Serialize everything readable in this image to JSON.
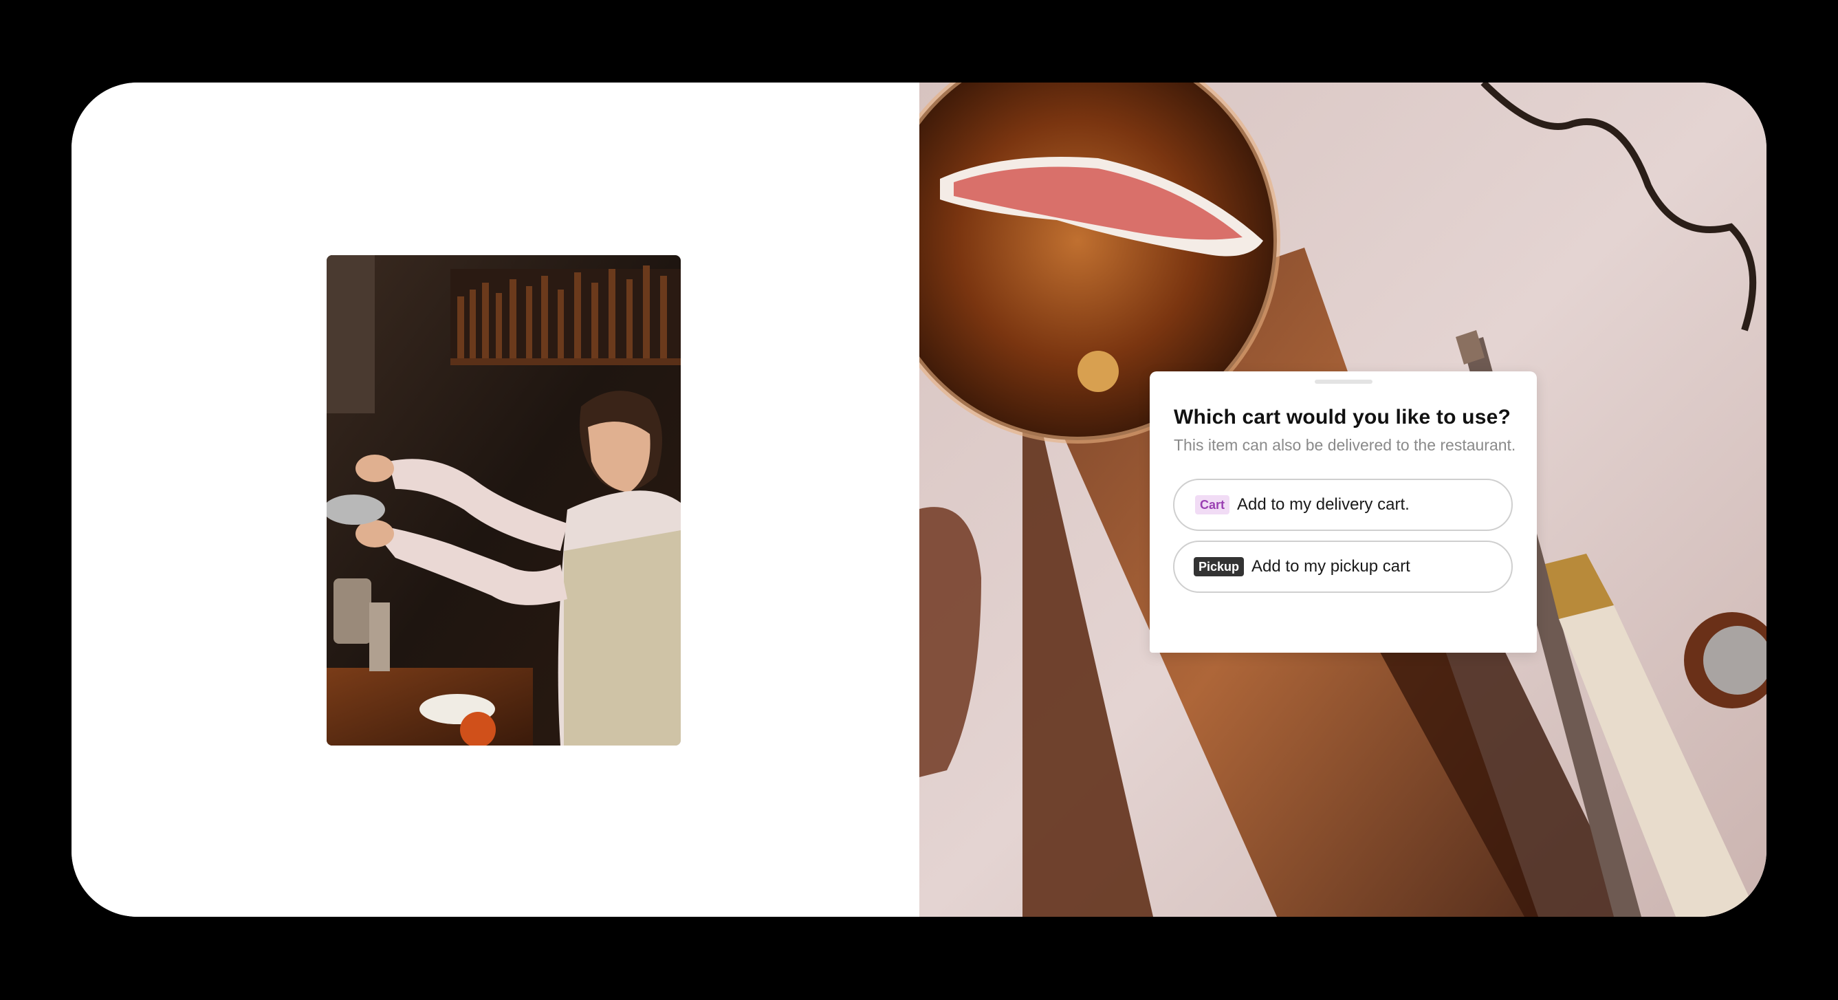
{
  "cart_sheet": {
    "title": "Which cart would you like to use?",
    "subtitle": "This item can also be delivered to the restaurant.",
    "options": [
      {
        "badge": "Cart",
        "label": "Add to my delivery cart.",
        "badge_color": "#9a3fb2",
        "badge_bg": "#f1dcf5"
      },
      {
        "badge": "Pickup",
        "label": "Add to my pickup cart",
        "badge_color": "#ffffff",
        "badge_bg": "#333333"
      }
    ]
  },
  "colors": {
    "background": "#000000",
    "panel": "#ffffff",
    "option_border": "#cfcfcf"
  }
}
